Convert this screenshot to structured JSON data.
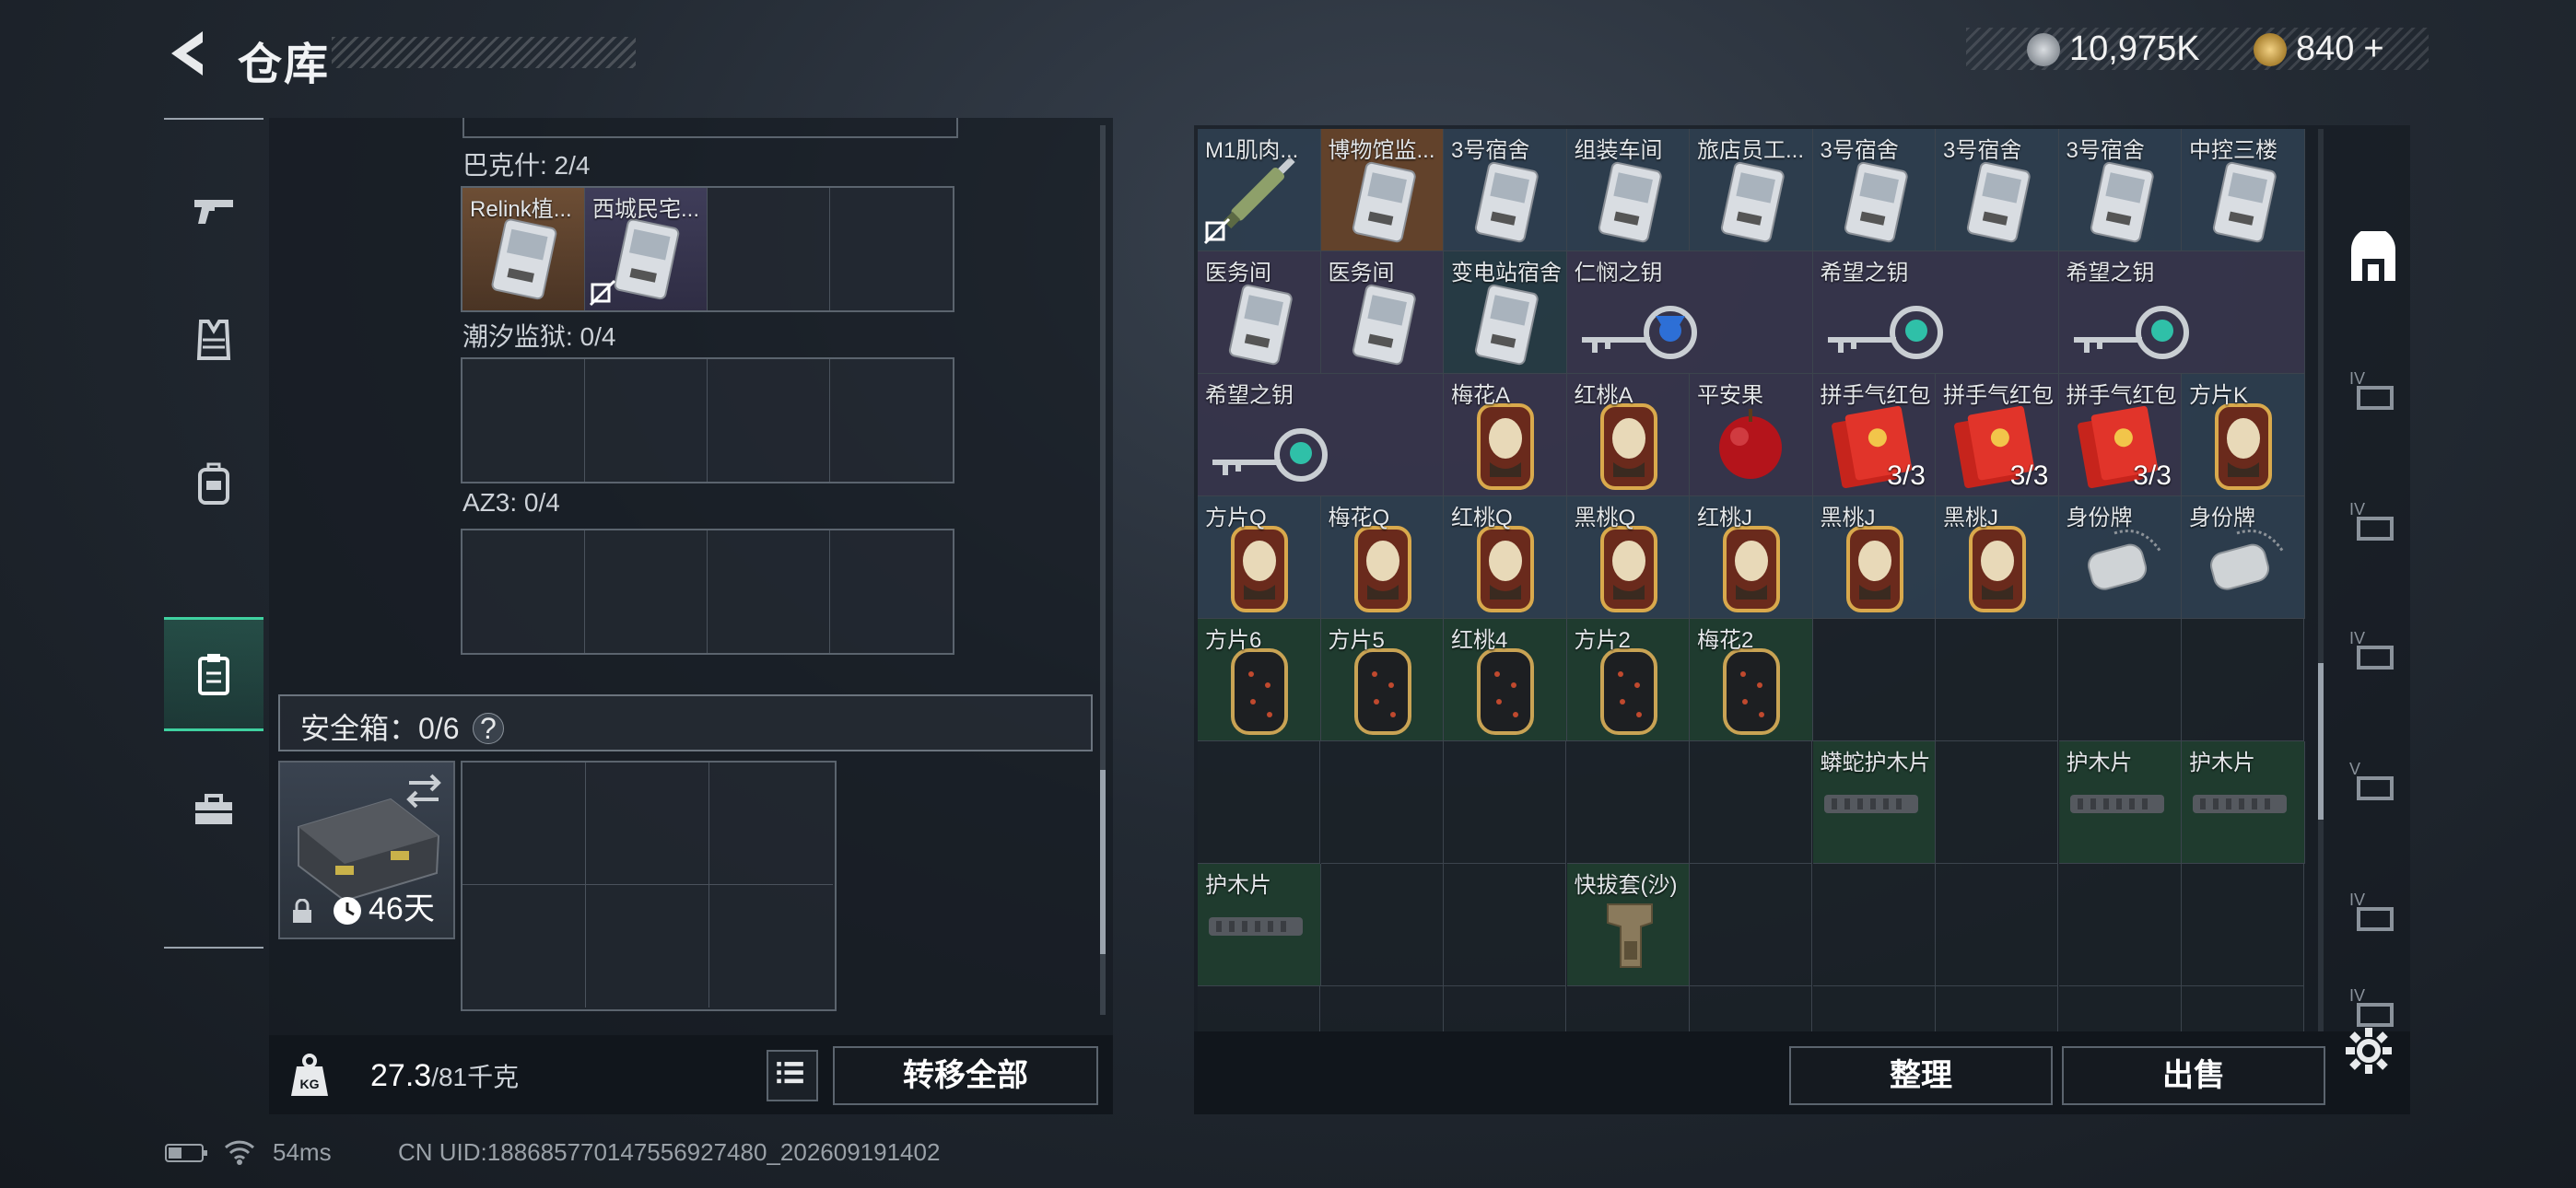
{
  "header": {
    "title": "仓库",
    "currency1": "10,975K",
    "currency2": "840",
    "plus": "+"
  },
  "left_tabs": [
    "gun-icon",
    "armor-vest-icon",
    "backpack-icon",
    "clipboard-icon",
    "toolbox-icon"
  ],
  "keycase": {
    "sections": [
      {
        "label": "巴克什: 2/4",
        "items": [
          "Relink植...",
          "西城民宅..."
        ]
      },
      {
        "label": "潮汐监狱: 0/4",
        "items": []
      },
      {
        "label": "AZ3: 0/4",
        "items": []
      }
    ]
  },
  "safebox": {
    "label": "安全箱：0/6",
    "help": "?",
    "days": "46天"
  },
  "footer": {
    "weight_current": "27.3",
    "weight_max": "/81千克",
    "transfer_all": "转移全部"
  },
  "right": {
    "sort": "整理",
    "sell": "出售"
  },
  "status": {
    "ping": "54ms",
    "uid": "CN UID:1886857701475569274​80_202609191402"
  },
  "stash_items": [
    {
      "label": "M1肌肉...",
      "type": "syringe",
      "bg": "blue"
    },
    {
      "label": "博物馆监...",
      "type": "card",
      "bg": "orange"
    },
    {
      "label": "3号宿舍",
      "type": "card",
      "bg": "blue"
    },
    {
      "label": "组装车间",
      "type": "card",
      "bg": "blue"
    },
    {
      "label": "旅店员工...",
      "type": "card",
      "bg": "blue"
    },
    {
      "label": "3号宿舍",
      "type": "card",
      "bg": "blue"
    },
    {
      "label": "3号宿舍",
      "type": "card",
      "bg": "blue"
    },
    {
      "label": "3号宿舍",
      "type": "card",
      "bg": "blue"
    },
    {
      "label": "中控三楼",
      "type": "card",
      "bg": "blue"
    },
    {
      "label": "医务间",
      "type": "card",
      "bg": "purple"
    },
    {
      "label": "医务间",
      "type": "card",
      "bg": "purple"
    },
    {
      "label": "变电站宿舍",
      "type": "card",
      "bg": "teal"
    },
    {
      "label": "仁悯之钥",
      "type": "key",
      "bg": "purple"
    },
    {
      "label": "希望之钥",
      "type": "key",
      "bg": "purple"
    },
    {
      "label": "希望之钥",
      "type": "key",
      "bg": "purple"
    },
    {
      "label": "希望之钥",
      "type": "key",
      "bg": "purple"
    },
    {
      "label": "梅花A",
      "type": "playcard",
      "bg": "purple"
    },
    {
      "label": "红桃A",
      "type": "playcard",
      "bg": "purple"
    },
    {
      "label": "平安果",
      "type": "apple",
      "bg": "purple"
    },
    {
      "label": "拼手气红包",
      "type": "redpacket",
      "bg": "purple",
      "qty": "3/3"
    },
    {
      "label": "拼手气红包",
      "type": "redpacket",
      "bg": "purple",
      "qty": "3/3"
    },
    {
      "label": "拼手气红包",
      "type": "redpacket",
      "bg": "purple",
      "qty": "3/3"
    },
    {
      "label": "方片K",
      "type": "playcard",
      "bg": "blue"
    },
    {
      "label": "方片Q",
      "type": "playcard",
      "bg": "blue"
    },
    {
      "label": "梅花Q",
      "type": "playcard",
      "bg": "blue"
    },
    {
      "label": "红桃Q",
      "type": "playcard",
      "bg": "blue"
    },
    {
      "label": "黑桃Q",
      "type": "playcard",
      "bg": "blue"
    },
    {
      "label": "红桃J",
      "type": "playcard",
      "bg": "blue"
    },
    {
      "label": "黑桃J",
      "type": "playcard",
      "bg": "blue"
    },
    {
      "label": "黑桃J",
      "type": "playcard",
      "bg": "blue"
    },
    {
      "label": "身份牌",
      "type": "dogtag",
      "bg": "blue"
    },
    {
      "label": "身份牌",
      "type": "dogtag",
      "bg": "blue"
    },
    {
      "label": "方片6",
      "type": "darkcard",
      "bg": "green"
    },
    {
      "label": "方片5",
      "type": "darkcard",
      "bg": "green"
    },
    {
      "label": "红桃4",
      "type": "darkcard",
      "bg": "green"
    },
    {
      "label": "方片2",
      "type": "darkcard",
      "bg": "green"
    },
    {
      "label": "梅花2",
      "type": "darkcard",
      "bg": "green"
    },
    {
      "label": "蟒蛇护木片",
      "type": "handguard",
      "bg": "green"
    },
    {
      "label": "护木片",
      "type": "handguard",
      "bg": "green"
    },
    {
      "label": "护木片",
      "type": "handguard",
      "bg": "green"
    },
    {
      "label": "护木片",
      "type": "handguard",
      "bg": "green"
    },
    {
      "label": "快拔套(沙)",
      "type": "holster",
      "bg": "green"
    }
  ],
  "colors": {
    "accent": "#3fd1a0",
    "panel": "#161c23"
  }
}
